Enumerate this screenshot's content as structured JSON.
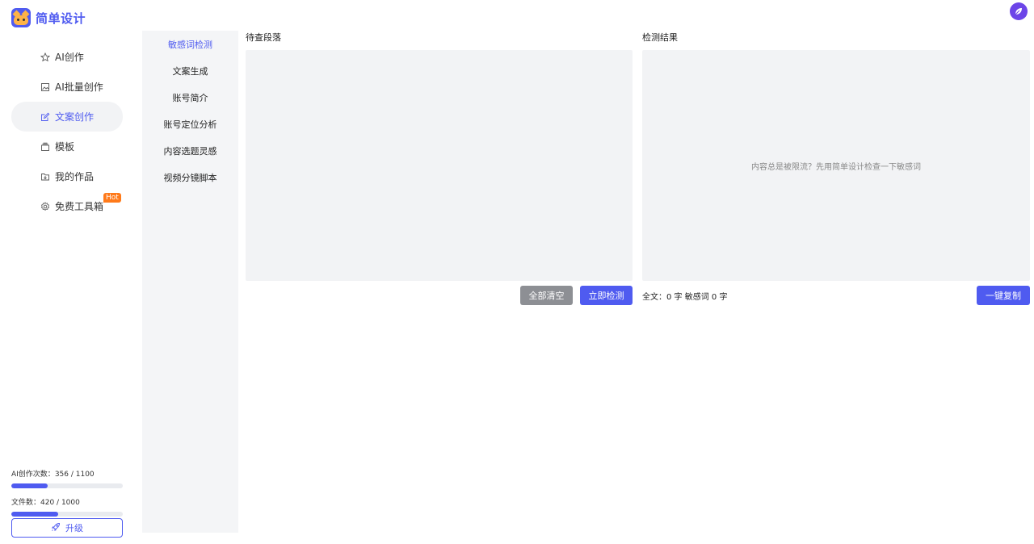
{
  "app": {
    "name": "简单设计"
  },
  "sidebar": {
    "items": [
      {
        "label": "AI创作",
        "icon": "star-icon"
      },
      {
        "label": "AI批量创作",
        "icon": "image-icon"
      },
      {
        "label": "文案创作",
        "icon": "edit-icon",
        "active": true
      },
      {
        "label": "模板",
        "icon": "template-icon"
      },
      {
        "label": "我的作品",
        "icon": "folder-icon"
      },
      {
        "label": "免费工具箱",
        "icon": "gear-icon",
        "badge": "Hot"
      }
    ]
  },
  "usage": {
    "ai_label": "AI创作次数：",
    "ai_value": "356 / 1100",
    "ai_fraction": 0.3236,
    "files_label": "文件数：",
    "files_value": "420 / 1000",
    "files_fraction": 0.42
  },
  "upgrade": {
    "label": "升级"
  },
  "submenu": {
    "items": [
      {
        "label": "敏感词检测",
        "active": true
      },
      {
        "label": "文案生成"
      },
      {
        "label": "账号简介"
      },
      {
        "label": "账号定位分析"
      },
      {
        "label": "内容选题灵感"
      },
      {
        "label": "视频分镜脚本"
      }
    ]
  },
  "input_panel": {
    "title": "待查段落",
    "value": "",
    "clear_label": "全部清空",
    "check_label": "立即检测"
  },
  "result_panel": {
    "title": "检测结果",
    "empty_message": "内容总是被限流？先用简单设计检查一下敏感词",
    "stats": "全文：0 字 敏感词 0 字",
    "copy_label": "一键复制"
  },
  "colors": {
    "accent": "#4f5bf0",
    "gray_button": "#8d8f94",
    "hot_badge": "#ff7a1a",
    "panel_bg": "#f2f3f5"
  }
}
